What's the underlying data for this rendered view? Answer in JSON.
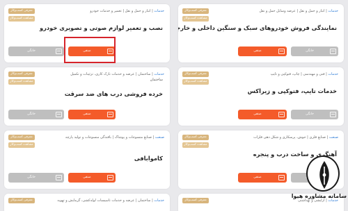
{
  "cards": [
    {
      "cat_main": "خدمات",
      "cat_sub": "انبار و حمل و نقل | عرضه وسایل حمل و نقل",
      "badge1": "معرفی کسب‌وکار",
      "badge2": "مشاهده کسب‌وکار",
      "title": "نمایندگی فروش خودروهای سبک و سنگین داخلی و خارجی",
      "subtitle": "",
      "btn_orange": "صنفی",
      "btn_gray": "خانگی"
    },
    {
      "cat_main": "خدمات",
      "cat_sub": "انبار و حمل و نقل | تعمیر و خدمات خودرو",
      "badge1": "معرفی کسب‌وکار",
      "badge2": "مشاهده کسب‌وکار",
      "title": "نصب و تعمیر لوازم صوتی و تصویری خودرو",
      "subtitle": "",
      "btn_orange": "صنفی",
      "btn_gray": "خانگی"
    },
    {
      "cat_main": "خدمات",
      "cat_sub": "فنی و مهندسی | چاپ، فتوکپی و تایپ",
      "badge1": "معرفی کسب‌وکار",
      "badge2": "مشاهده کسب‌وکار",
      "title": "خدمات تایپ، فتوکپی و زیراکس",
      "subtitle": "",
      "btn_orange": "صنفی",
      "btn_gray": "خانگی"
    },
    {
      "cat_main": "خدمات",
      "cat_sub": "ساختمان | عرضه و خدمات نازک کاری، تزئینات و تکمیل",
      "badge1": "معرفی کسب‌وکار",
      "badge2": "مشاهده کسب‌وکار",
      "title": "خرده فروشی درب های ضد سرقت",
      "subtitle": "ساختمان",
      "btn_orange": "صنفی",
      "btn_gray": "خانگی"
    },
    {
      "cat_main": "صنعت",
      "cat_sub": "صنایع فلزی | جوش، پرسکاری و شکل دهی فلزات",
      "badge1": "معرفی کسب‌وکار",
      "badge2": "مشاهده کسب‌وکار",
      "title": "آهنگری و ساخت درب و پنجره",
      "subtitle": "",
      "btn_orange": "صنفی",
      "btn_gray": "خانگی"
    },
    {
      "cat_main": "صنعت",
      "cat_sub": "صنایع منسوجات و پوشاک | بافندگی منسوجات و تولید پارچه",
      "badge1": "معرفی کسب‌وکار",
      "badge2": "مشاهده کسب‌وکار",
      "title": "کاموابافی",
      "subtitle": "",
      "btn_orange": "صنفی",
      "btn_gray": "خانگی"
    },
    {
      "cat_main": "خدمات",
      "cat_sub": "آرایشی و بهداشتی",
      "badge1": "معرفی کسب‌وکار",
      "badge2": "",
      "title": "",
      "subtitle": "",
      "btn_orange": "",
      "btn_gray": ""
    },
    {
      "cat_main": "خدمات",
      "cat_sub": "ساختمان | عرضه و خدمات تاسیسات لوله‌کشی، گرمایش و تهویه",
      "badge1": "معرفی کسب‌وکار",
      "badge2": "",
      "title": "",
      "subtitle": "",
      "btn_orange": "",
      "btn_gray": ""
    }
  ],
  "logo": {
    "line1": "سامانه مشاوره هیوا",
    "line2": ""
  },
  "colors": {
    "accent_orange": "#f45b2a",
    "badge_gold": "#d8b57c",
    "category_blue": "#2d7bd6",
    "highlight_red": "#d6232a",
    "button_gray": "#bfbfbf"
  }
}
